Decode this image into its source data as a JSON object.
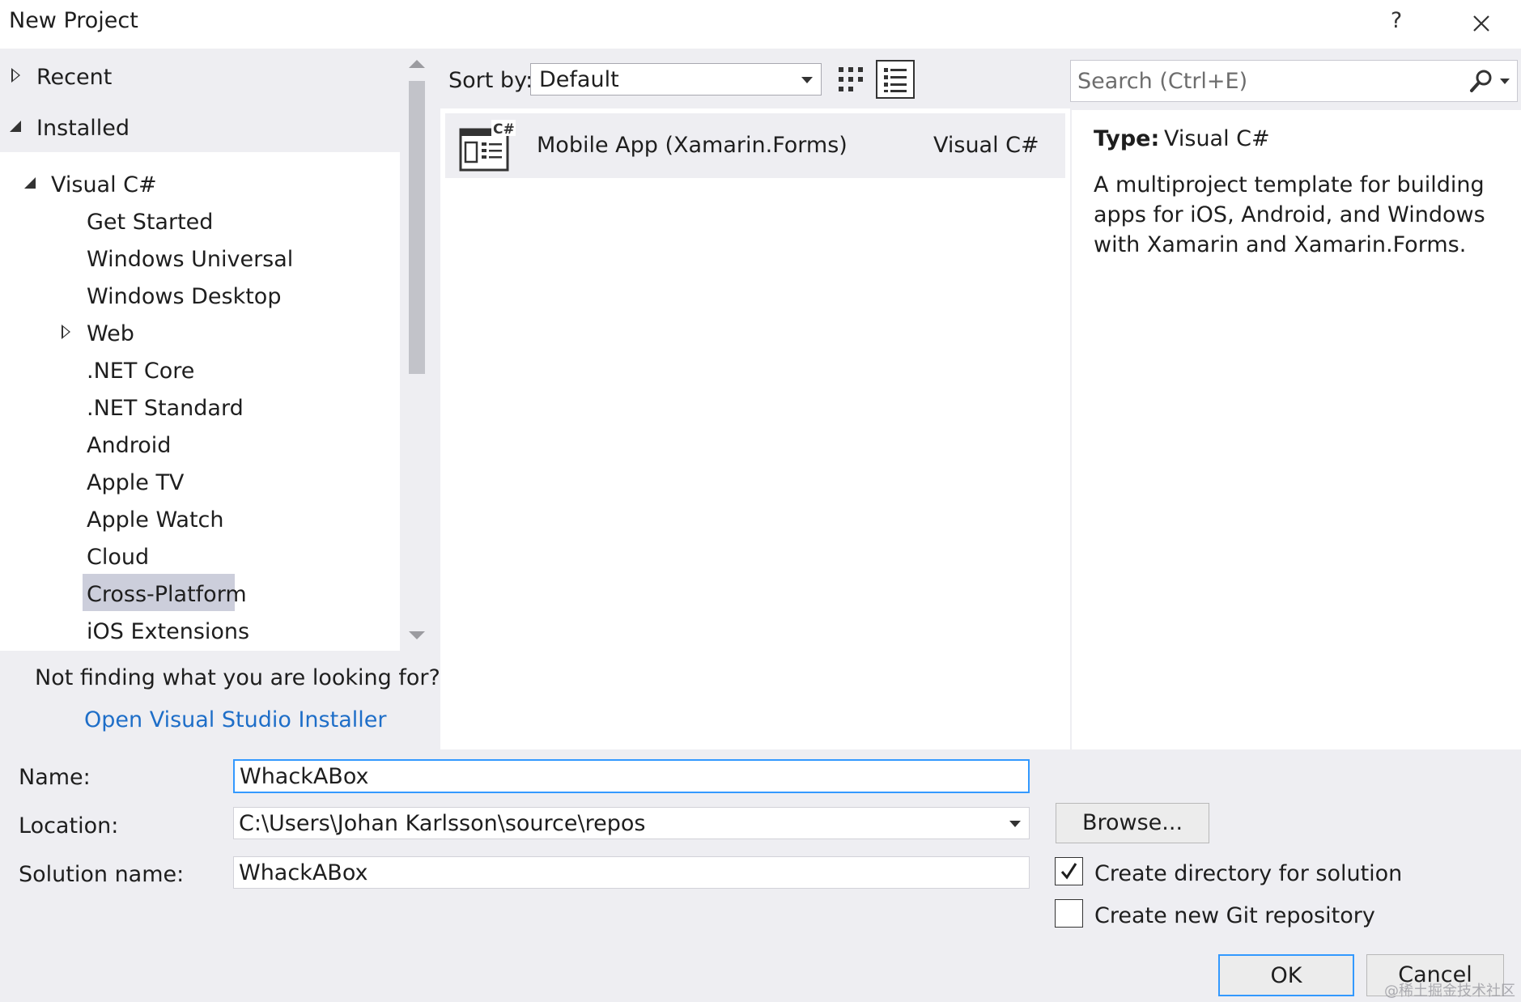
{
  "window": {
    "title": "New Project",
    "help_label": "?"
  },
  "tree": {
    "recent": "Recent",
    "installed": "Installed",
    "visual_csharp": "Visual C#",
    "items": [
      "Get Started",
      "Windows Universal",
      "Windows Desktop",
      "Web",
      ".NET Core",
      ".NET Standard",
      "Android",
      "Apple TV",
      "Apple Watch",
      "Cloud",
      "Cross-Platform",
      "iOS Extensions"
    ],
    "selected": "Cross-Platform"
  },
  "not_finding": {
    "text": "Not finding what you are looking for?",
    "link": "Open Visual Studio Installer"
  },
  "toolbar": {
    "sort_label": "Sort by:",
    "sort_value": "Default"
  },
  "search": {
    "placeholder": "Search (Ctrl+E)"
  },
  "template": {
    "name": "Mobile App (Xamarin.Forms)",
    "language": "Visual C#",
    "icon_badge": "C#"
  },
  "details": {
    "type_label": "Type:",
    "type_value": "Visual C#",
    "description": "A multiproject template for building apps for iOS, Android, and Windows with Xamarin and Xamarin.Forms."
  },
  "form": {
    "name_label": "Name:",
    "name_value": "WhackABox",
    "location_label": "Location:",
    "location_value": "C:\\Users\\Johan Karlsson\\source\\repos",
    "solution_label": "Solution name:",
    "solution_value": "WhackABox",
    "browse": "Browse...",
    "create_dir_label": "Create directory for solution",
    "create_dir_checked": true,
    "create_git_label": "Create new Git repository",
    "create_git_checked": false,
    "ok": "OK",
    "cancel": "Cancel"
  },
  "watermark": "@稀土掘金技术社区",
  "colors": {
    "pane_bg": "#eeeef2",
    "selection": "#cccedb",
    "link": "#1e6ec8",
    "focus": "#3399ff"
  }
}
